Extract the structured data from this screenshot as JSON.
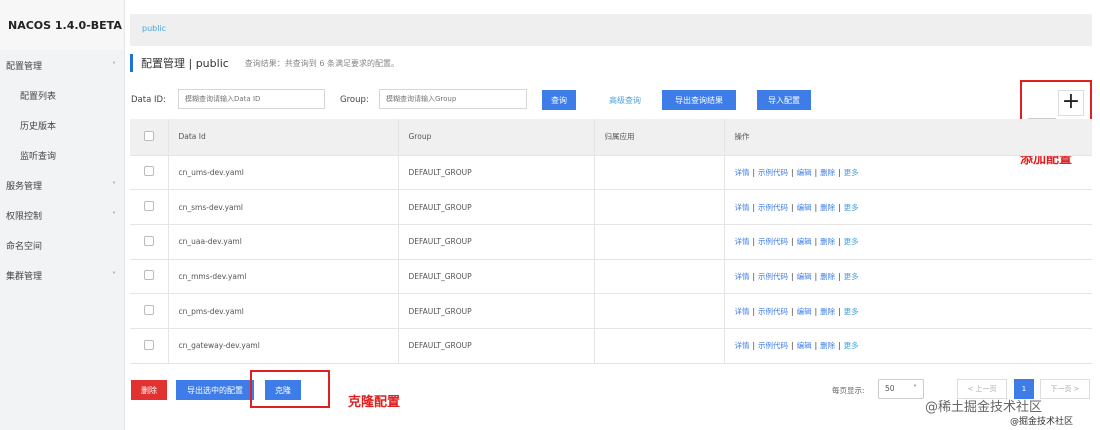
{
  "brand": "NACOS 1.4.0-BETA",
  "sidebar": {
    "items": [
      {
        "label": "配置管理",
        "arrow": "˄"
      },
      {
        "label": "配置列表"
      },
      {
        "label": "历史版本"
      },
      {
        "label": "监听查询"
      },
      {
        "label": "服务管理",
        "arrow": "˅"
      },
      {
        "label": "权限控制",
        "arrow": "˅"
      },
      {
        "label": "命名空间"
      },
      {
        "label": "集群管理",
        "arrow": "˅"
      }
    ]
  },
  "breadcrumb": "public",
  "page": {
    "title": "配置管理 | public",
    "desc": "查询结果：共查询到 6 条满足要求的配置。"
  },
  "search": {
    "dataid_label": "Data ID:",
    "dataid_placeholder": "模糊查询请输入Data ID",
    "group_label": "Group:",
    "group_placeholder": "模糊查询请输入Group",
    "query_button": "查询",
    "advanced_link": "高级查询",
    "export_button": "导出查询结果",
    "import_button": "导入配置"
  },
  "add": {
    "symbol": "+",
    "annotation": "添加配置"
  },
  "table": {
    "headers": [
      "Data Id",
      "Group",
      "归属应用",
      "操作"
    ],
    "rows": [
      {
        "data_id": "cn_ums-dev.yaml",
        "group": "DEFAULT_GROUP",
        "app": ""
      },
      {
        "data_id": "cn_sms-dev.yaml",
        "group": "DEFAULT_GROUP",
        "app": ""
      },
      {
        "data_id": "cn_uaa-dev.yaml",
        "group": "DEFAULT_GROUP",
        "app": ""
      },
      {
        "data_id": "cn_mms-dev.yaml",
        "group": "DEFAULT_GROUP",
        "app": ""
      },
      {
        "data_id": "cn_pms-dev.yaml",
        "group": "DEFAULT_GROUP",
        "app": ""
      },
      {
        "data_id": "cn_gateway-dev.yaml",
        "group": "DEFAULT_GROUP",
        "app": ""
      }
    ],
    "ops": [
      "详情",
      "示例代码",
      "编辑",
      "删除",
      "更多"
    ]
  },
  "footer": {
    "delete_button": "删除",
    "export_selected_button": "导出选中的配置",
    "clone_button": "克隆",
    "clone_annotation": "克隆配置"
  },
  "pager": {
    "label": "每页显示:",
    "size": "50",
    "prev": "< 上一页",
    "current": "1",
    "next": "下一页 >"
  },
  "watermark": "@稀土掘金技术社区",
  "watermark2": "@掘金技术社区"
}
